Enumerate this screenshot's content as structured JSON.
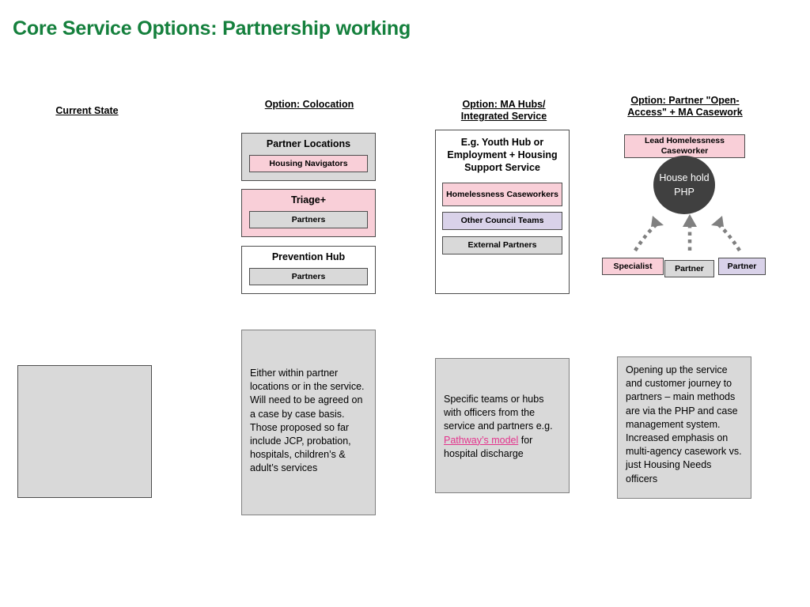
{
  "slide": {
    "title": "Core Service Options: Partnership working"
  },
  "columns": {
    "current_state": {
      "header": "Current State",
      "empty_box_label": ""
    },
    "colocation": {
      "header": "Option: Colocation",
      "boxes": [
        {
          "title": "Partner Locations",
          "fill": "gray",
          "chip": {
            "label": "Housing Navigators",
            "fill": "pink"
          }
        },
        {
          "title": "Triage+",
          "fill": "pink",
          "chip": {
            "label": "Partners",
            "fill": "gray"
          }
        },
        {
          "title": "Prevention Hub",
          "fill": "white",
          "chip": {
            "label": "Partners",
            "fill": "gray"
          }
        }
      ],
      "description": "Either within partner locations or in the service. Will need to be agreed on a case by case basis. Those proposed so far include JCP, probation, hospitals, children’s & adult’s services"
    },
    "ma_hubs": {
      "header_line1": "Option: MA Hubs/",
      "header_line2": "Integrated Service",
      "box_title": "E.g. Youth Hub or Employment + Housing Support Service",
      "chips": [
        {
          "label": "Homelessness Caseworkers",
          "fill": "pink"
        },
        {
          "label": "Other Council Teams",
          "fill": "lavender"
        },
        {
          "label": "External Partners",
          "fill": "gray"
        }
      ],
      "description_part1": "Specific teams or hubs with officers from the service and partners e.g. ",
      "description_link": "Pathway’s model",
      "description_part2": " for hospital discharge"
    },
    "partner_open_access": {
      "header_line1": "Option: Partner \"Open-",
      "header_line2": "Access\" + MA Casework",
      "lead_box": {
        "label": "Lead Homelessness Caseworker",
        "fill": "pink"
      },
      "circle": {
        "label": "House hold PHP",
        "fill": "#404040",
        "text_color": "#ffffff"
      },
      "bottom_chips": [
        {
          "label": "Specialist",
          "fill": "pink"
        },
        {
          "label": "Partner",
          "fill": "gray"
        },
        {
          "label": "Partner",
          "fill": "lavender"
        }
      ],
      "description": "Opening up the service and customer journey to partners – main methods are via the PHP and case management system. Increased emphasis on multi-agency casework vs. just Housing Needs officers"
    }
  },
  "palette": {
    "title_green": "#15803d",
    "pink": "#f9cfd8",
    "lavender": "#d9d2e9",
    "gray": "#d9d9d9",
    "border": "#4d4d4d",
    "circle": "#404040",
    "link_pink": "#e3338c"
  }
}
